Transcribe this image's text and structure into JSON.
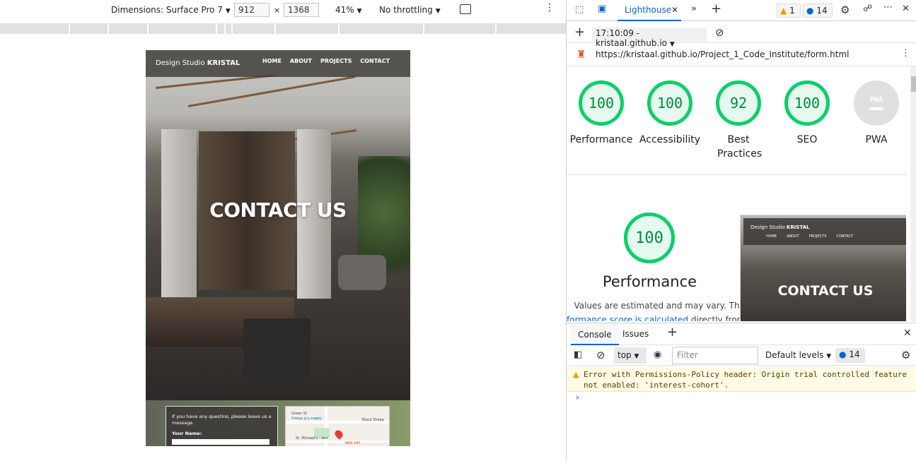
{
  "toolbar": {
    "dimensions_label": "Dimensions: Surface Pro 7",
    "width": "912",
    "height": "1368",
    "times": "×",
    "zoom": "41%",
    "throttling": "No throttling",
    "more": "⋮"
  },
  "site": {
    "brand_prefix": "Design Studio ",
    "brand_bold": "KRISTAL",
    "nav": [
      "HOME",
      "ABOUT",
      "PROJECTS",
      "CONTACT"
    ],
    "hero_title": "CONTACT US",
    "form_intro": "If you have any questins, please leave us a message.",
    "form_name_label": "Your Name:",
    "map_labels": [
      "Green St",
      "Улица угу кирру",
      "St. Michael's - Ave",
      "BAR 160",
      "Black Sheep"
    ]
  },
  "devtools": {
    "tab_label": "Lighthouse",
    "warn_count": "1",
    "info_count": "14",
    "report_time": "17:10:09 - kristaal.github.io",
    "url": "https://kristaal.github.io/Project_1_Code_Institute/form.html",
    "scores": [
      {
        "value": "100",
        "label": "Performance"
      },
      {
        "value": "100",
        "label": "Accessibility"
      },
      {
        "value": "92",
        "label": "Best Practices"
      },
      {
        "value": "100",
        "label": "SEO"
      },
      {
        "value": "",
        "label": "PWA"
      }
    ],
    "pwa_badge": "PWA",
    "perf_score": "100",
    "perf_title": "Performance",
    "perf_note_1": "Values are estimated and may vary. The",
    "perf_note_link": "formance score is calculated",
    "perf_note_2": " directly from these",
    "thumb_brand_prefix": "Design Studio ",
    "thumb_brand_bold": "KRISTAL",
    "thumb_nav": [
      "HOME",
      "ABOUT",
      "PROJECTS",
      "CONTACT"
    ],
    "thumb_title": "CONTACT US"
  },
  "console": {
    "tabs": [
      "Console",
      "Issues"
    ],
    "context": "top",
    "filter_placeholder": "Filter",
    "levels": "Default levels",
    "badge_count": "14",
    "error_text": "Error with Permissions-Policy header: Origin trial controlled feature not enabled: 'interest-cohort'.",
    "prompt": "›"
  },
  "colors": {
    "accent": "#0a64c8",
    "score_green": "#0cce6b",
    "warning_bg": "#fffbe5"
  },
  "icons": [
    "inspect-icon",
    "device-toolbar-icon",
    "chevron-right-double-icon",
    "plus-icon",
    "warning-icon",
    "message-icon",
    "gear-icon",
    "people-icon",
    "close-icon",
    "clear-icon",
    "lighthouse-logo-icon",
    "kebab-icon",
    "sidebar-icon",
    "eye-icon",
    "rotate-icon"
  ]
}
